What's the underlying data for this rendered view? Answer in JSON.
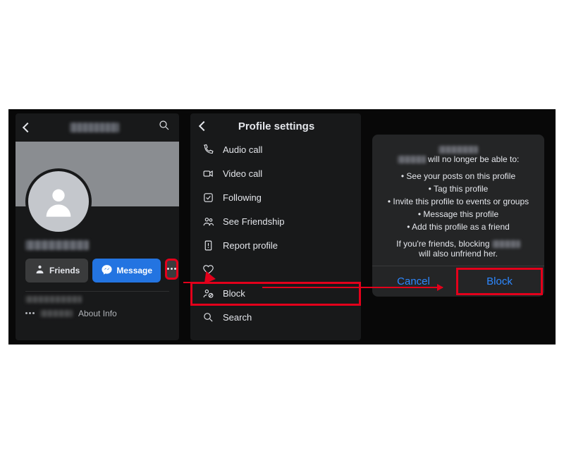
{
  "panel1": {
    "friends_label": "Friends",
    "message_label": "Message",
    "about_label": "About Info"
  },
  "panel2": {
    "title": "Profile settings",
    "items": [
      {
        "label": "Audio call"
      },
      {
        "label": "Video call"
      },
      {
        "label": "Following"
      },
      {
        "label": "See Friendship"
      },
      {
        "label": "Report profile"
      },
      {
        "label": ""
      },
      {
        "label": "Block"
      },
      {
        "label": "Search"
      }
    ]
  },
  "dialog": {
    "line1_suffix": " will no longer be able to:",
    "bullets": [
      "See your posts on this profile",
      "Tag this profile",
      "Invite this profile to events or groups",
      "Message this profile",
      "Add this profile as a friend"
    ],
    "line2_prefix": "If you're friends, blocking ",
    "line2_suffix": " will also unfriend her.",
    "cancel_label": "Cancel",
    "block_label": "Block"
  },
  "colors": {
    "accent_red": "#e3001b",
    "link_blue": "#2d88ff"
  }
}
